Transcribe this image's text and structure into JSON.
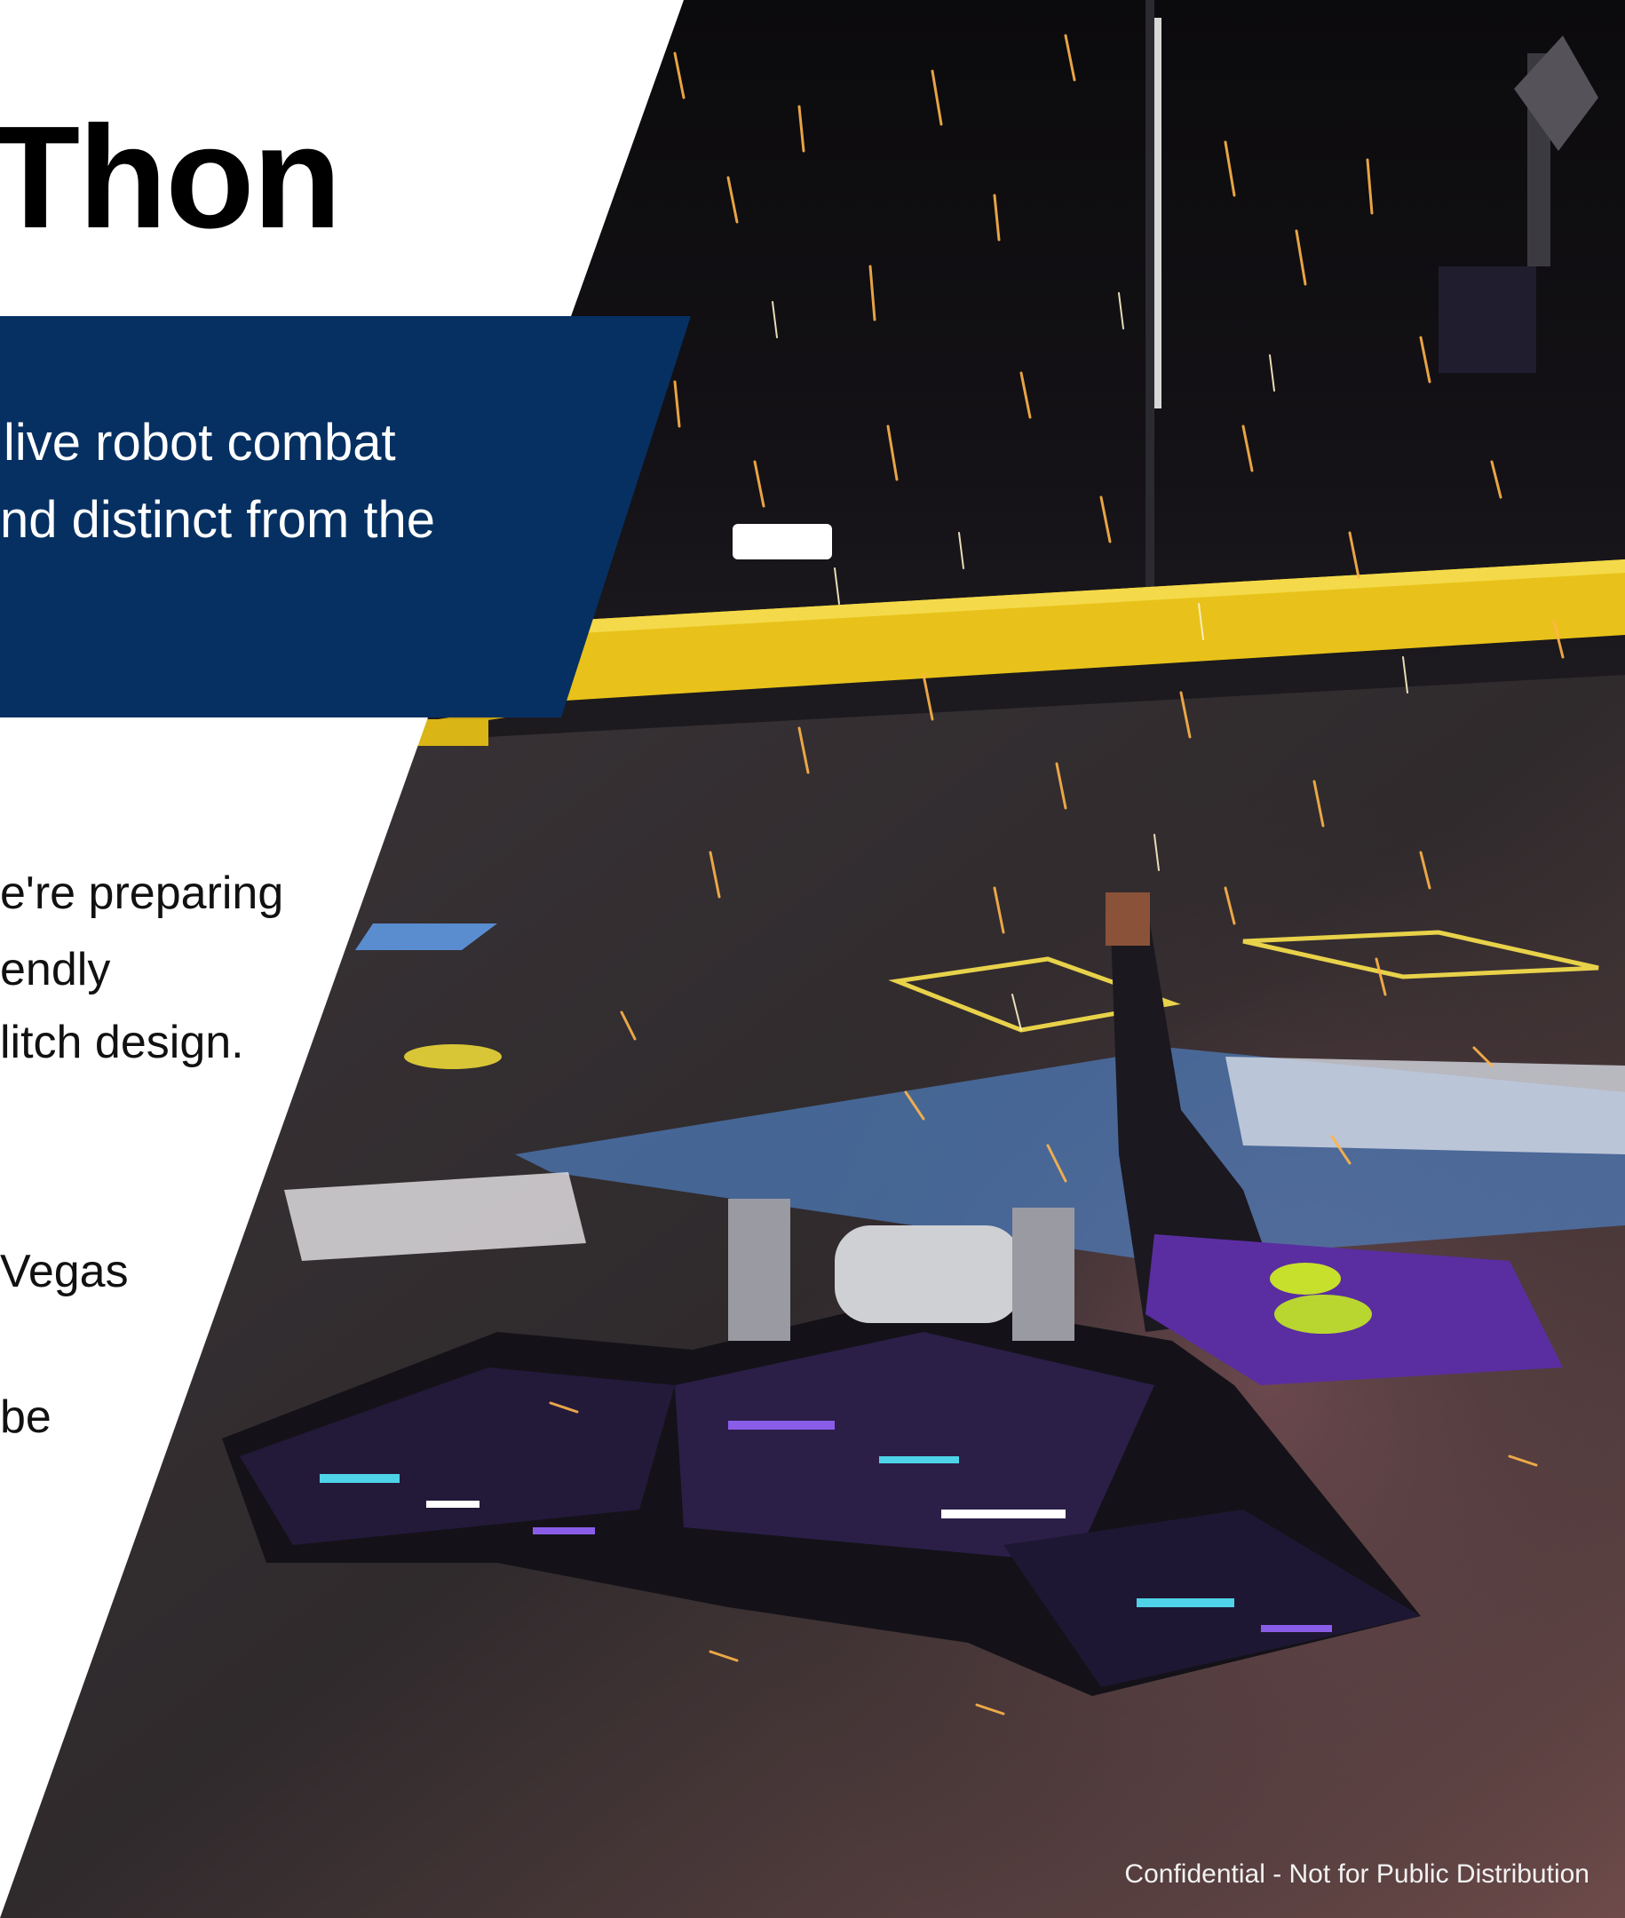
{
  "slide": {
    "title": "Thon",
    "banner_lines": [
      "live robot combat",
      "nd distinct from the"
    ],
    "body_lines": [
      "e're preparing",
      "endly",
      "litch design.",
      "Vegas",
      "be"
    ],
    "footer": "Confidential - Not for Public Distribution"
  },
  "colors": {
    "banner": "#063062",
    "arena_yellow": "#e8c21a",
    "arena_floor": "#2e2a2d",
    "robot_purple": "#5a2ea0"
  },
  "photo": {
    "subject": "combat-robot-with-sparks"
  }
}
